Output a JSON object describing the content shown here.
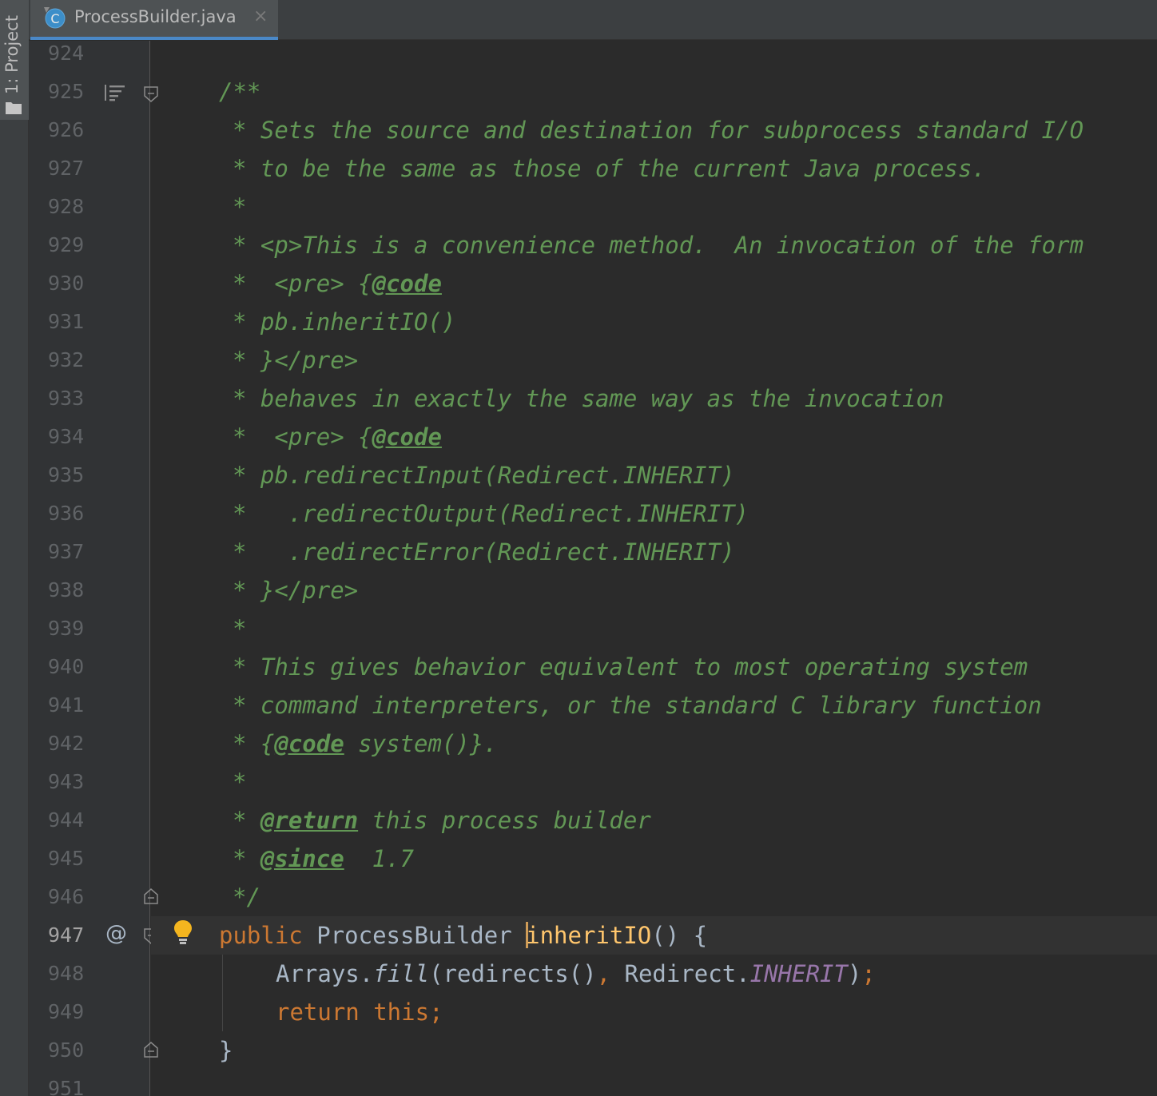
{
  "side_panel": {
    "project_tab_label": "1: Project"
  },
  "editor_tab": {
    "file_name": "ProcessBuilder.java",
    "close_glyph": "×",
    "icon_letter": "C"
  },
  "gutter": {
    "line_numbers": [
      "924",
      "925",
      "926",
      "927",
      "928",
      "929",
      "930",
      "931",
      "932",
      "933",
      "934",
      "935",
      "936",
      "937",
      "938",
      "939",
      "940",
      "941",
      "942",
      "943",
      "944",
      "945",
      "946",
      "947",
      "948",
      "949",
      "950",
      "951"
    ],
    "current_line": "947",
    "override_marker": "@"
  },
  "code": {
    "l925": "/**",
    "l926": "* Sets the source and destination for subprocess standard I/O",
    "l927": "* to be the same as those of the current Java process.",
    "l928": "*",
    "l929": "* <p>This is a convenience method.  An invocation of the form",
    "l930_pre": "*  <pre> {",
    "l930_tag": "@code",
    "l931": "* pb.inheritIO()",
    "l932": "* }</pre>",
    "l933": "* behaves in exactly the same way as the invocation",
    "l934_pre": "*  <pre> {",
    "l934_tag": "@code",
    "l935": "* pb.redirectInput(Redirect.INHERIT)",
    "l936": "*   .redirectOutput(Redirect.INHERIT)",
    "l937": "*   .redirectError(Redirect.INHERIT)",
    "l938": "* }</pre>",
    "l939": "*",
    "l940": "* This gives behavior equivalent to most operating system",
    "l941": "* command interpreters, or the standard C library function",
    "l942_pre": "* {",
    "l942_tag": "@code",
    "l942_post": " system()}.",
    "l943": "*",
    "l944_pre": "* ",
    "l944_tag": "@return",
    "l944_post": " this process builder",
    "l945_pre": "* ",
    "l945_tag": "@since",
    "l945_post": "  1.7",
    "l946": "*/",
    "l947_kw": "public",
    "l947_type": " ProcessBuilder ",
    "l947_name": "inheritIO",
    "l947_post": "() {",
    "l948_cls": "Arrays.",
    "l948_fn": "fill",
    "l948_args": "(redirects()",
    "l948_comma": ", ",
    "l948_cls2": "Redirect.",
    "l948_const": "INHERIT",
    "l948_close": ")",
    "l948_semi": ";",
    "l949_kw1": "return",
    "l949_kw2": " this;",
    "l950": "}"
  },
  "colors": {
    "background": "#2b2b2b",
    "gutter": "#313335",
    "comment": "#629755",
    "keyword": "#cc7832",
    "identifier": "#a9b7c6",
    "method_decl": "#ffc66d",
    "constant": "#9876aa",
    "tab_accent": "#4a88c7"
  }
}
